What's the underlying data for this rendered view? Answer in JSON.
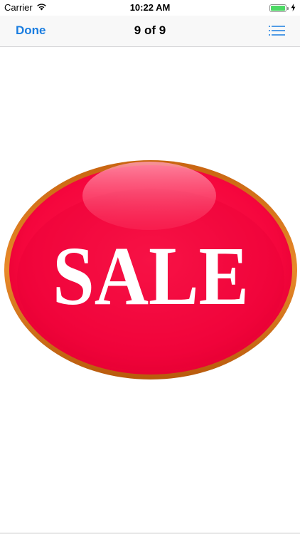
{
  "status_bar": {
    "carrier": "Carrier",
    "time": "10:22 AM",
    "battery_level": 1.0,
    "wifi_icon": "wifi-icon",
    "charging_icon": "bolt-icon"
  },
  "nav": {
    "done_label": "Done",
    "title": "9 of 9",
    "list_icon": "list-icon"
  },
  "image": {
    "badge_text": "SALE",
    "colors": {
      "badge_red": "#f5063d",
      "badge_rim": "#d9781a",
      "text": "#ffffff",
      "accent": "#1a7de0"
    }
  }
}
